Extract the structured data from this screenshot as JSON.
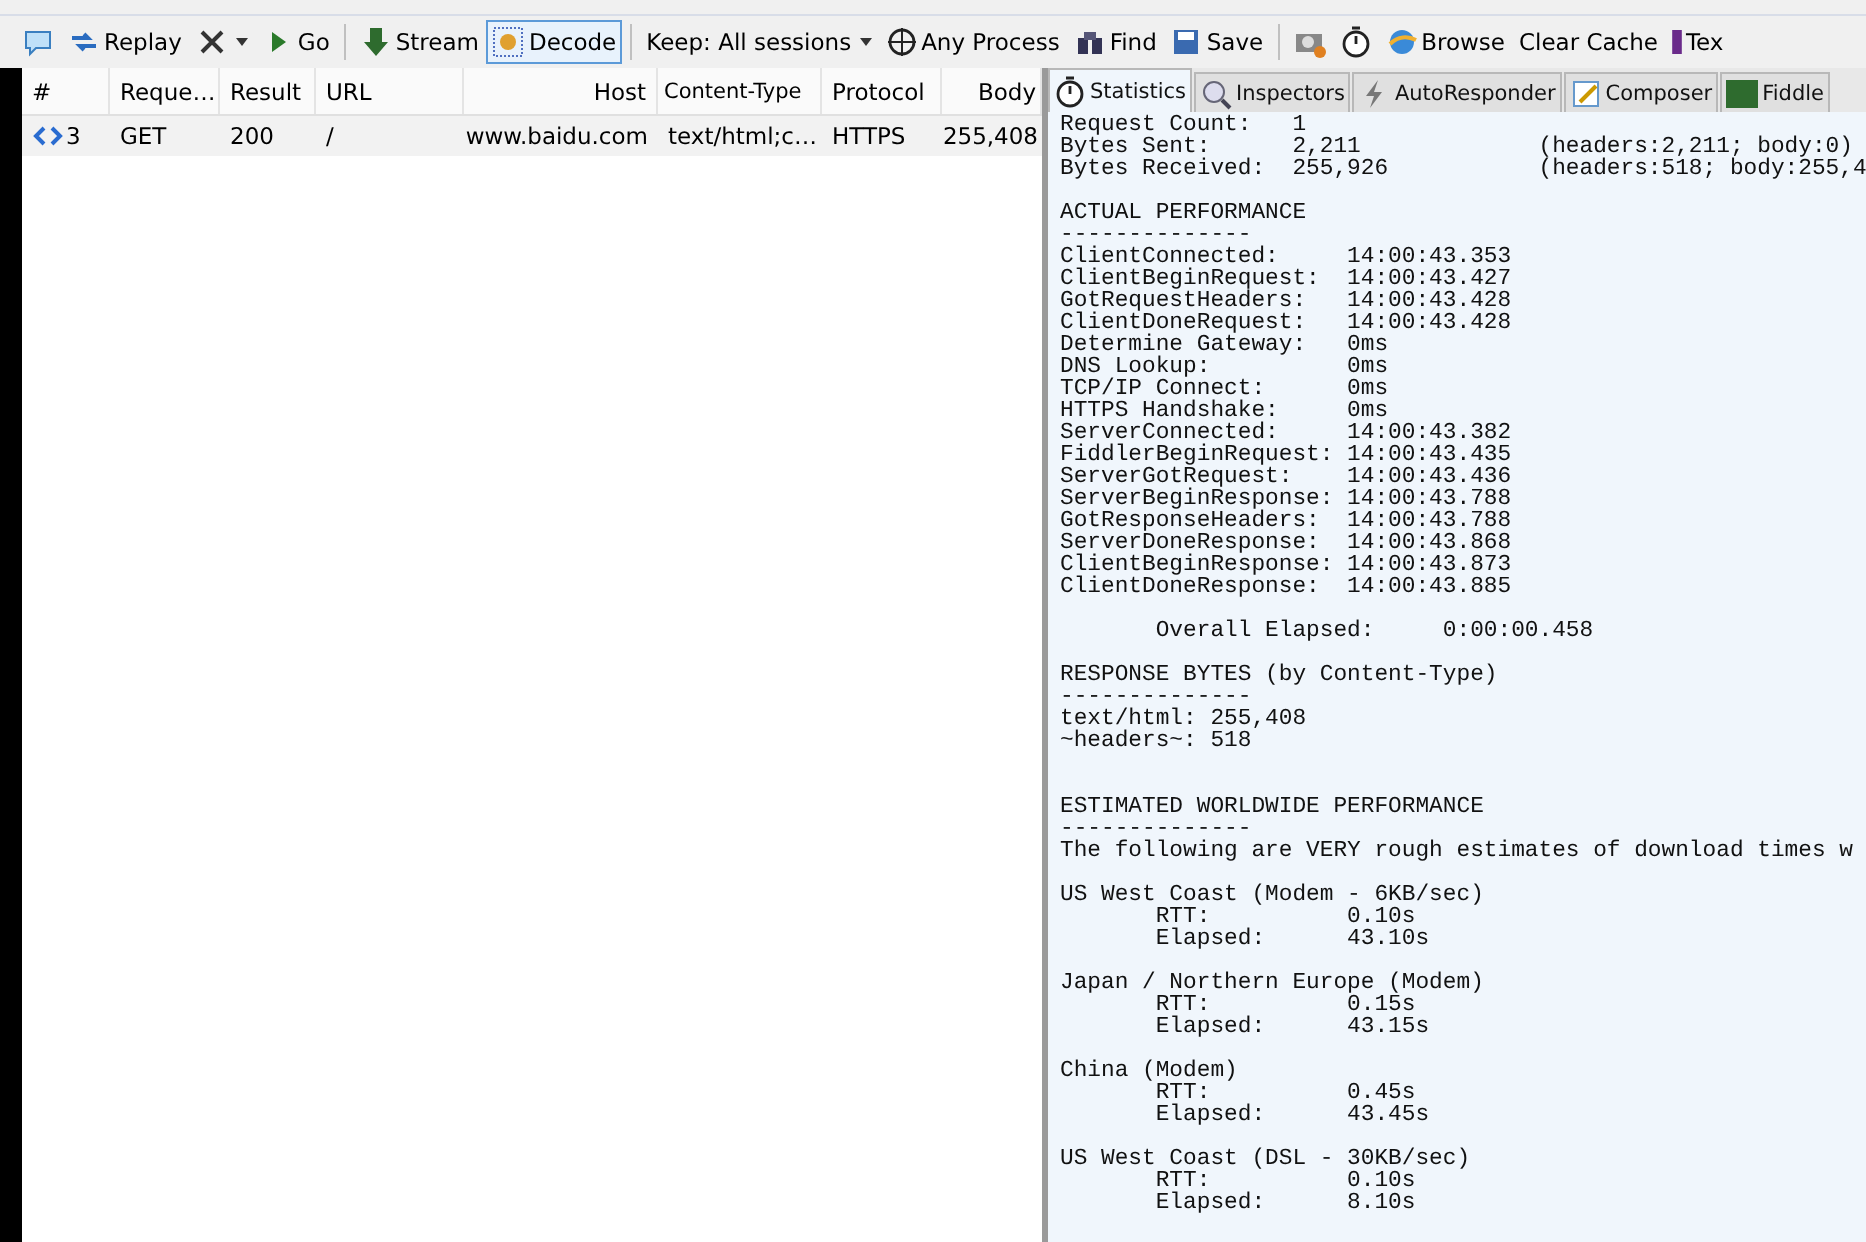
{
  "toolbar": [
    {
      "kind": "icon-button",
      "pressed": false
    },
    {
      "kind": "button",
      "label": "Replay",
      "pressed": false
    },
    {
      "kind": "dropdown",
      "pressed": false
    },
    {
      "kind": "button",
      "label": "Go",
      "pressed": false
    },
    {
      "kind": "separator"
    },
    {
      "kind": "button",
      "label": "Stream",
      "pressed": false
    },
    {
      "kind": "button",
      "label": "Decode",
      "pressed": true
    },
    {
      "kind": "separator"
    },
    {
      "kind": "dropdown",
      "label": "Keep: All sessions",
      "pressed": false
    },
    {
      "kind": "button",
      "label": "Any Process",
      "pressed": false
    },
    {
      "kind": "button",
      "label": "Find",
      "pressed": false
    },
    {
      "kind": "button",
      "label": "Save",
      "pressed": false
    },
    {
      "kind": "separator"
    },
    {
      "kind": "icon-button",
      "pressed": false
    },
    {
      "kind": "icon-button",
      "pressed": false
    },
    {
      "kind": "button",
      "label": "Browse",
      "pressed": false
    },
    {
      "kind": "button",
      "label": "Clear Cache",
      "pressed": false
    },
    {
      "kind": "button",
      "label": "Tex",
      "pressed": false
    }
  ],
  "sessions": {
    "columns": [
      "#",
      "Reque…",
      "Result",
      "URL",
      "Host",
      "Content-Type",
      "Protocol",
      "Body"
    ],
    "rows": [
      {
        "cells": [
          "3",
          "GET",
          "200",
          "/",
          "www.baidu.com",
          "text/html;c…",
          "HTTPS",
          "255,408"
        ]
      }
    ]
  },
  "tabs": [
    {
      "label": "Statistics",
      "selected": true
    },
    {
      "label": "Inspectors",
      "selected": false
    },
    {
      "label": "AutoResponder",
      "selected": false
    },
    {
      "label": "Composer",
      "selected": false
    },
    {
      "label": "Fiddle",
      "selected": false
    }
  ],
  "statistics": [
    {
      "lines": [
        "Request Count:   1",
        "Bytes Sent:      2,211             (headers:2,211; body:0)",
        "Bytes Received:  255,926           (headers:518; body:255,4"
      ]
    },
    {
      "lines": [
        "ACTUAL PERFORMANCE",
        "--------------",
        "ClientConnected:     14:00:43.353",
        "ClientBeginRequest:  14:00:43.427",
        "GotRequestHeaders:   14:00:43.428",
        "ClientDoneRequest:   14:00:43.428",
        "Determine Gateway:   0ms",
        "DNS Lookup:          0ms",
        "TCP/IP Connect:      0ms",
        "HTTPS Handshake:     0ms",
        "ServerConnected:     14:00:43.382",
        "FiddlerBeginRequest: 14:00:43.435",
        "ServerGotRequest:    14:00:43.436",
        "ServerBeginResponse: 14:00:43.788",
        "GotResponseHeaders:  14:00:43.788",
        "ServerDoneResponse:  14:00:43.868",
        "ClientBeginResponse: 14:00:43.873",
        "ClientDoneResponse:  14:00:43.885"
      ]
    },
    {
      "lines": [
        "       Overall Elapsed:     0:00:00.458"
      ]
    },
    {
      "lines": [
        "RESPONSE BYTES (by Content-Type)",
        "--------------",
        "text/html: 255,408",
        "~headers~: 518"
      ]
    },
    {
      "lines": [
        "ESTIMATED WORLDWIDE PERFORMANCE",
        "--------------",
        "The following are VERY rough estimates of download times w"
      ]
    },
    {
      "lines": [
        "US West Coast (Modem - 6KB/sec)",
        "       RTT:          0.10s",
        "       Elapsed:      43.10s"
      ]
    },
    {
      "lines": [
        "Japan / Northern Europe (Modem)",
        "       RTT:          0.15s",
        "       Elapsed:      43.15s"
      ]
    },
    {
      "lines": [
        "China (Modem)",
        "       RTT:          0.45s",
        "       Elapsed:      43.45s"
      ]
    },
    {
      "lines": [
        "US West Coast (DSL - 30KB/sec)",
        "       RTT:          0.10s",
        "       Elapsed:      8.10s"
      ]
    }
  ]
}
